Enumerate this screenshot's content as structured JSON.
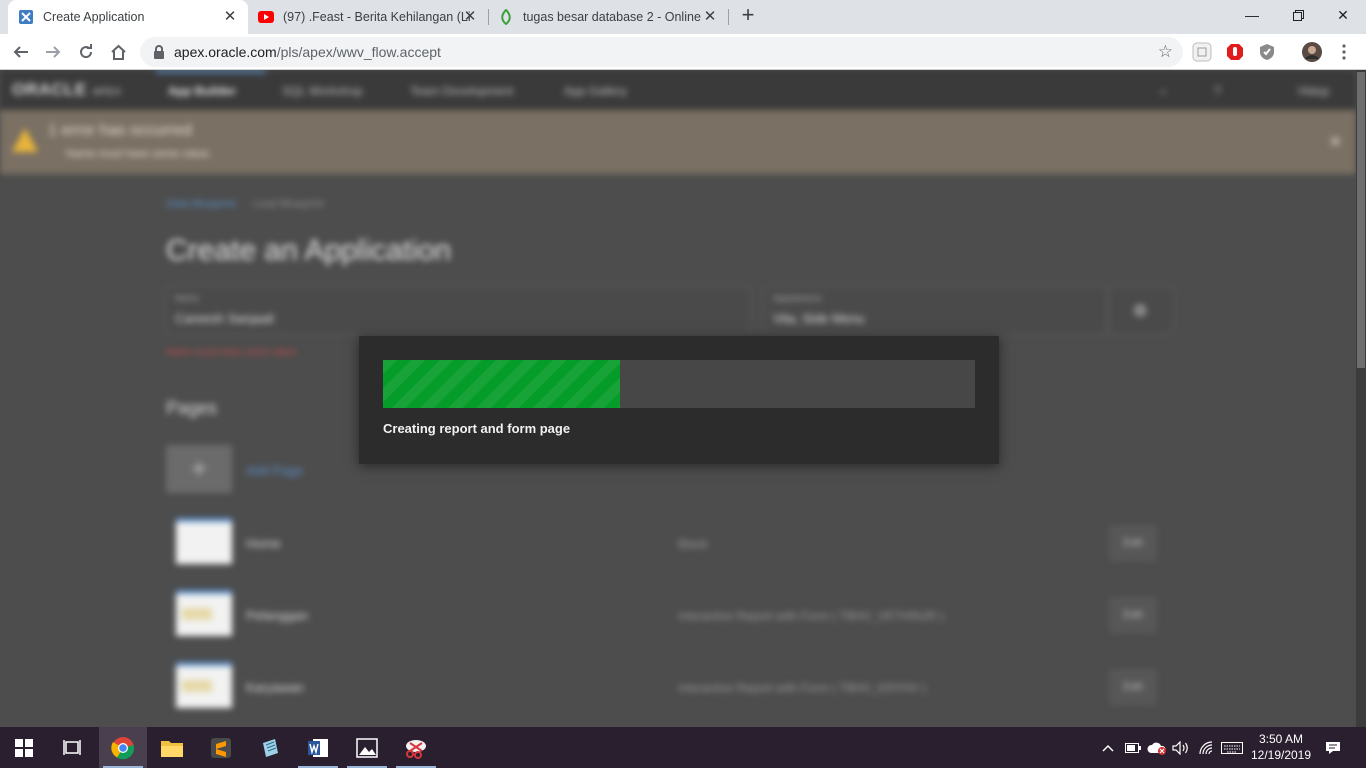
{
  "browser": {
    "tabs": [
      {
        "title": "Create Application",
        "icon": "apex-icon",
        "active": true
      },
      {
        "title": "(97) .Feast - Berita Kehilangan (Li",
        "icon": "youtube-icon",
        "active": false
      },
      {
        "title": "tugas besar database 2 - Online",
        "icon": "page-icon",
        "active": false
      }
    ],
    "url_host": "apex.oracle.com",
    "url_path": "/pls/apex/wwv_flow.accept"
  },
  "apex_page": {
    "logo": "ORACLE",
    "logo_sub": "APEX",
    "nav": [
      "App Builder",
      "SQL Workshop",
      "Team Development",
      "App Gallery"
    ],
    "user": "Hidup",
    "alert_title": "1 error has occurred",
    "alert_detail": "Name must have some value.",
    "breadcrumb": [
      "Data Blueprint",
      "Load Blueprint"
    ],
    "title": "Create an Application",
    "name_label": "Name",
    "name_value": "Careesh Sanjaali",
    "appearance_label": "Appearance",
    "appearance_value": "Vita, Side Menu",
    "name_error": "Name must have some value.",
    "pages_heading": "Pages",
    "add_page": "Add Page",
    "pages": [
      {
        "name": "Home",
        "desc": "Blank",
        "edit": "Edit"
      },
      {
        "name": "Pelanggan",
        "desc": "Interactive Report with Form ( TBHV_VETHINJR )",
        "edit": "Edit"
      },
      {
        "name": "Karyawan",
        "desc": "Interactive Report with Form ( TBHV_KRYHV )",
        "edit": "Edit"
      }
    ]
  },
  "progress": {
    "message": "Creating report and form page",
    "value": 0.4,
    "color": "#069c2a"
  },
  "taskbar": {
    "time": "3:50 AM",
    "date": "12/19/2019"
  }
}
